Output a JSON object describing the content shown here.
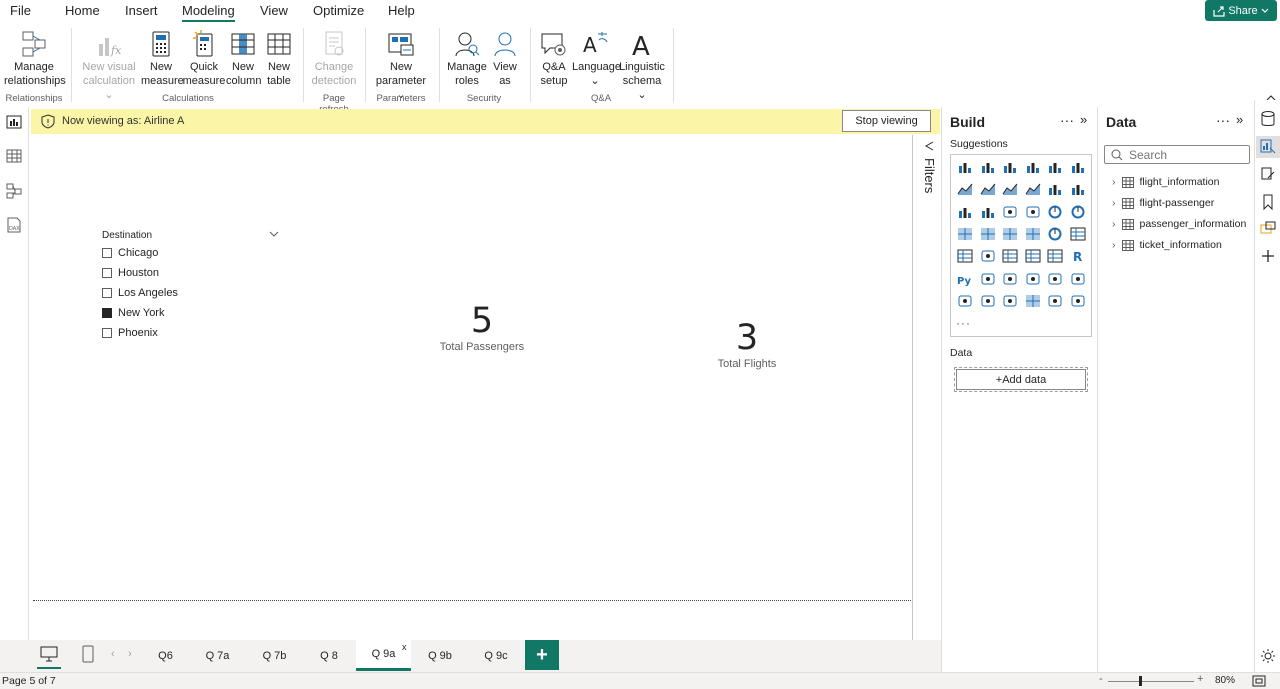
{
  "menu": {
    "file": "File",
    "home": "Home",
    "insert": "Insert",
    "modeling": "Modeling",
    "view": "View",
    "optimize": "Optimize",
    "help": "Help",
    "share": "Share"
  },
  "ribbon": {
    "manage_relationships": [
      "Manage",
      "relationships"
    ],
    "new_visual_calc": [
      "New visual",
      "calculation"
    ],
    "new_measure": [
      "New",
      "measure"
    ],
    "quick_measure": [
      "Quick",
      "measure"
    ],
    "new_column": [
      "New",
      "column"
    ],
    "new_table": [
      "New",
      "table"
    ],
    "change_detection": [
      "Change",
      "detection"
    ],
    "new_parameter": [
      "New",
      "parameter"
    ],
    "manage_roles": [
      "Manage",
      "roles"
    ],
    "view_as": [
      "View",
      "as"
    ],
    "qa_setup": [
      "Q&A",
      "setup"
    ],
    "language": "Language",
    "linguistic_schema": [
      "Linguistic",
      "schema"
    ],
    "groups": {
      "relationships": "Relationships",
      "calculations": "Calculations",
      "page_refresh": "Page refresh",
      "parameters": "Parameters",
      "security": "Security",
      "qa": "Q&A"
    }
  },
  "banner": {
    "text": "Now viewing as: Airline A",
    "stop": "Stop viewing"
  },
  "slicer": {
    "title": "Destination",
    "items": [
      {
        "label": "Chicago",
        "checked": false
      },
      {
        "label": "Houston",
        "checked": false
      },
      {
        "label": "Los Angeles",
        "checked": false
      },
      {
        "label": "New York",
        "checked": true
      },
      {
        "label": "Phoenix",
        "checked": false
      }
    ]
  },
  "cards": [
    {
      "value": "5",
      "label": "Total Passengers"
    },
    {
      "value": "3",
      "label": "Total Flights"
    }
  ],
  "filters_label": "Filters",
  "build": {
    "title": "Build",
    "suggestions": "Suggestions",
    "data_label": "Data",
    "add_data": "+Add data",
    "more": "···"
  },
  "data_pane": {
    "title": "Data",
    "search_placeholder": "Search",
    "tables": [
      "flight_information",
      "flight-passenger",
      "passenger_information",
      "ticket_information"
    ]
  },
  "tabs": [
    "Q6",
    "Q 7a",
    "Q 7b",
    "Q 8",
    "Q 9a",
    "Q 9b",
    "Q 9c"
  ],
  "active_tab": "Q 9a",
  "tab_close": "x",
  "add_page": "+",
  "status": {
    "page": "Page 5 of 7",
    "zoom": "80%"
  },
  "colors": {
    "accent": "#117865",
    "banner": "#fbf5a7",
    "viz_blue": "#1f6fb5"
  }
}
